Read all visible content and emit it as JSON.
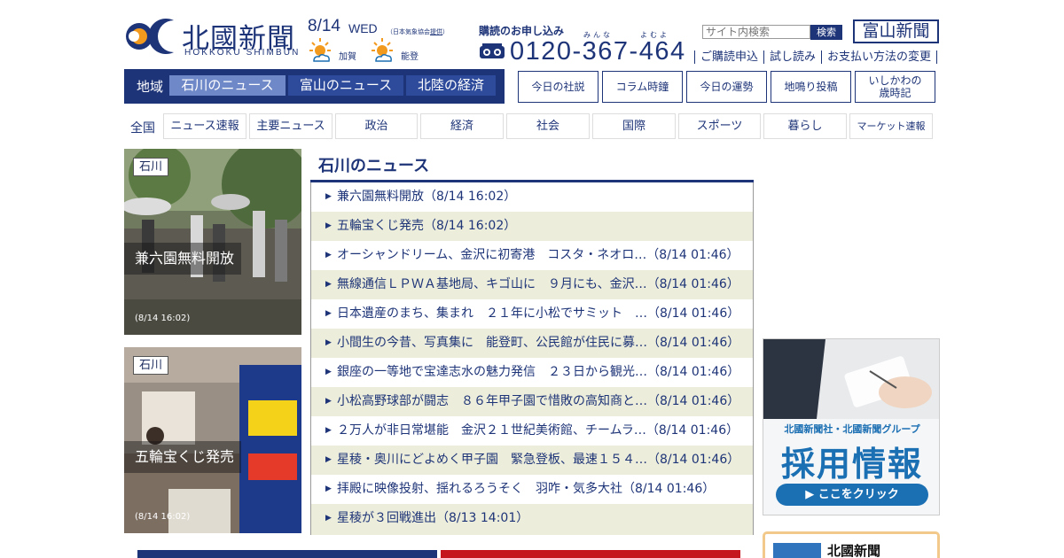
{
  "header": {
    "logo_text": "北國新聞",
    "logo_sub": "HOKKOKU SHIMBUN",
    "date": "8/14",
    "weekday": "WED",
    "credit_text": "（日本気象協会",
    "credit_link": "提供",
    "credit_end": "）",
    "weather": [
      {
        "label": "加賀",
        "icon": "sun-cloud-icon"
      },
      {
        "label": "能登",
        "icon": "sun-cloud-icon"
      }
    ],
    "subscribe_label": "購読のお申し込み",
    "ruby_minna": "みんな",
    "ruby_yoyo": "よむよ",
    "phone": "0120-367-464",
    "search_placeholder": "サイト内検索",
    "search_button": "検索",
    "toyama_logo": "富山新聞",
    "top_links": [
      "ご購読申込",
      "試し読み",
      "お支払い方法の変更"
    ]
  },
  "region_nav": {
    "label": "地域",
    "tabs": [
      "石川のニュース",
      "富山のニュース",
      "北陸の経済"
    ],
    "active": 0
  },
  "box_buttons": [
    "今日の社説",
    "コラム時鐘",
    "今日の運勢",
    "地鳴り投稿",
    "いしかわの",
    "歳時記"
  ],
  "category_nav": {
    "all": "全国",
    "items": [
      "ニュース速報",
      "主要ニュース",
      "政治",
      "経済",
      "社会",
      "国際",
      "スポーツ",
      "暮らし",
      "マーケット速報"
    ]
  },
  "cards": [
    {
      "tag": "石川",
      "title": "兼六園無料開放",
      "time": "(8/14 16:02)"
    },
    {
      "tag": "石川",
      "title": "五輪宝くじ発売",
      "time": "(8/14 16:02)"
    }
  ],
  "news_list": {
    "title": "石川のニュース",
    "items": [
      "兼六園無料開放（8/14 16:02）",
      "五輪宝くじ発売（8/14 16:02）",
      "オーシャンドリーム、金沢に初寄港　コスタ・ネオロ…（8/14 01:46）",
      "無線通信ＬＰＷＡ基地局、キゴ山に　９月にも、金沢…（8/14 01:46）",
      "日本遺産のまち、集まれ　２１年に小松でサミット　…（8/14 01:46）",
      "小間生の今昔、写真集に　能登町、公民館が住民に募…（8/14 01:46）",
      "銀座の一等地で宝達志水の魅力発信　２３日から観光…（8/14 01:46）",
      "小松高野球部が闘志　８６年甲子園で惜敗の高知商と…（8/14 01:46）",
      "２万人が非日常堪能　金沢２１世紀美術館、チームラ…（8/14 01:46）",
      "星稜・奥川にどよめく甲子園　緊急登板、最速１５４…（8/14 01:46）",
      "拝殿に映像投射、揺れるろうそく　羽咋・気多大社（8/14 01:46）",
      "星稜が３回戦進出（8/13 14:01）"
    ]
  },
  "ad": {
    "company": "北國新聞社・北國新聞グループ",
    "title": "採用情報",
    "button": "▶ ここをクリック"
  },
  "paper_box": {
    "name": "北國新聞"
  },
  "colors": {
    "navy": "#1e3478",
    "alt_row": "#ecedda",
    "ad_blue": "#1b6fb3"
  }
}
